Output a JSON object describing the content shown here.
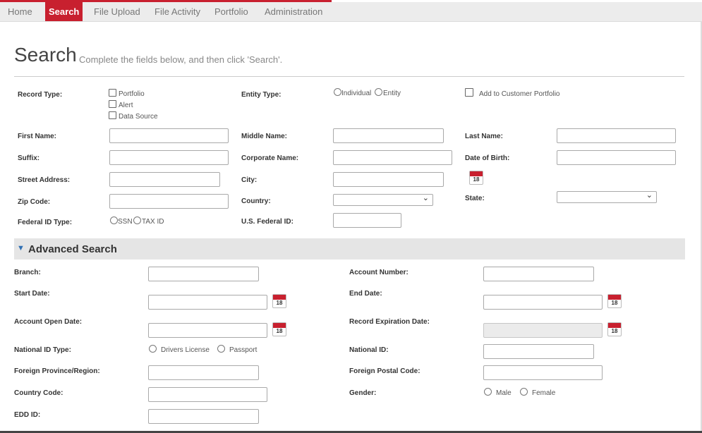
{
  "nav": {
    "items": [
      {
        "label": "Home",
        "active": false
      },
      {
        "label": "Search",
        "active": true
      },
      {
        "label": "File Upload",
        "active": false
      },
      {
        "label": "File Activity",
        "active": false
      },
      {
        "label": "Portfolio",
        "active": false
      },
      {
        "label": "Administration",
        "active": false
      }
    ]
  },
  "page": {
    "title": "Search",
    "subtitle": "Complete the fields below, and then click 'Search'."
  },
  "form": {
    "record_type_label": "Record Type:",
    "record_type_options": [
      "Portfolio",
      "Alert",
      "Data Source"
    ],
    "entity_type_label": "Entity Type:",
    "entity_type_options": [
      "Individual",
      "Entity"
    ],
    "add_to_portfolio_label": "Add to Customer Portfolio",
    "first_name_label": "First Name:",
    "middle_name_label": "Middle Name:",
    "last_name_label": "Last Name:",
    "suffix_label": "Suffix:",
    "corporate_name_label": "Corporate Name:",
    "dob_label": "Date of Birth:",
    "street_label": "Street Address:",
    "city_label": "City:",
    "zip_label": "Zip Code:",
    "country_label": "Country:",
    "state_label": "State:",
    "federal_id_type_label": "Federal ID Type:",
    "federal_id_type_options": [
      "SSN",
      "TAX ID"
    ],
    "us_federal_id_label": "U.S. Federal ID:",
    "calendar_day": "18"
  },
  "advanced": {
    "title": "Advanced Search",
    "branch_label": "Branch:",
    "account_number_label": "Account Number:",
    "start_date_label": "Start Date:",
    "end_date_label": "End Date:",
    "account_open_date_label": "Account Open Date:",
    "record_expiration_label": "Record Expiration Date:",
    "national_id_type_label": "National ID Type:",
    "national_id_type_options": [
      "Drivers License",
      "Passport"
    ],
    "national_id_label": "National ID:",
    "foreign_province_label": "Foreign Province/Region:",
    "foreign_postal_label": "Foreign Postal Code:",
    "country_code_label": "Country Code:",
    "gender_label": "Gender:",
    "gender_options": [
      "Male",
      "Female"
    ],
    "edd_id_label": "EDD ID:"
  },
  "colors": {
    "accent": "#c8202f",
    "advanced_bar": "#e5e5e5",
    "triangle": "#2f6fb3"
  },
  "icons": {
    "calendar": "calendar-icon",
    "dropdown": "chevron-down-icon",
    "collapse": "triangle-down-icon"
  }
}
